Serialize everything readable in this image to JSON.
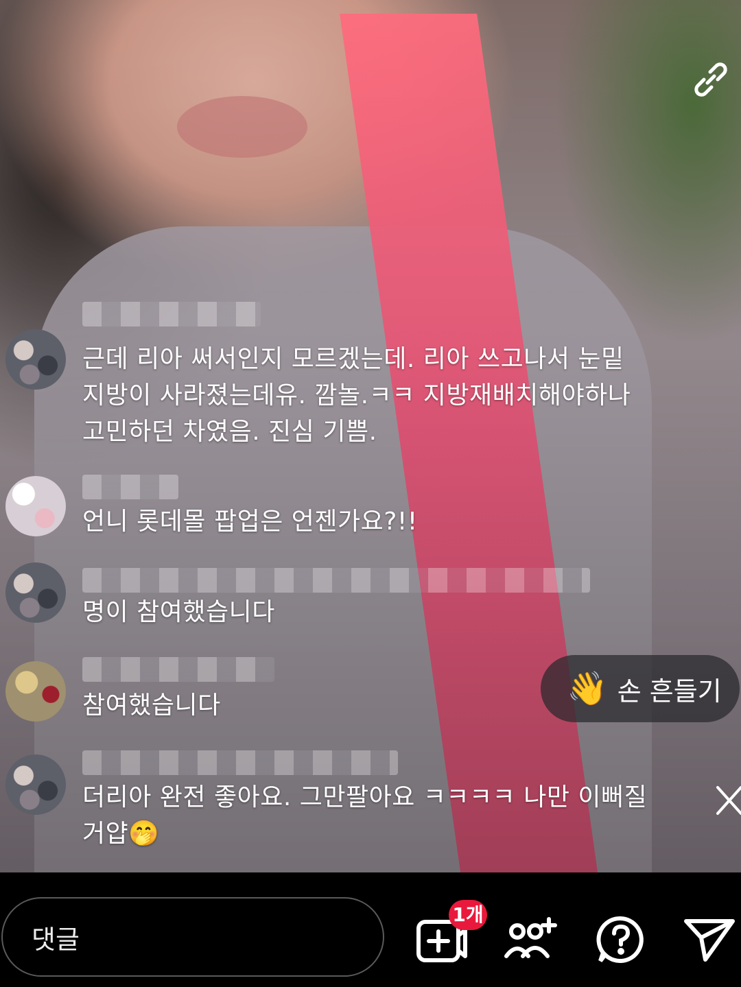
{
  "comments": [
    {
      "text": "근데 리아 써서인지 모르겠는데. 리아 쓰고나서 눈밑\n지방이 사라졌는데유. 깜놀.ㅋㅋ 지방재배치해야하나\n고민하던 차였음. 진심 기쁨."
    },
    {
      "text": "언니 롯데몰 팝업은 언젠가요?!!"
    },
    {
      "text": "명이 참여했습니다"
    },
    {
      "text": "참여했습니다"
    },
    {
      "text": "더리아 완전 좋아요. 그만팔아요 ㅋㅋㅋㅋ 나만 이뻐질\n거얍🤭"
    }
  ],
  "wave_button": {
    "emoji": "👋",
    "label": "손 흔들기"
  },
  "comment_input": {
    "placeholder": "댓글"
  },
  "toolbar": {
    "add_badge": "1개",
    "icons": [
      "add-media-icon",
      "invite-guest-icon",
      "question-icon",
      "send-icon"
    ]
  },
  "colors": {
    "badge": "#e8193c",
    "strap": "#f0557a"
  }
}
